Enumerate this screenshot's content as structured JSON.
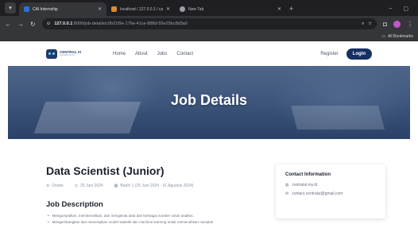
{
  "browser": {
    "tabs": [
      {
        "label": "CAI Internship",
        "active": true
      },
      {
        "label": "localhost / 127.0.0.1 / cai-inter",
        "active": false
      },
      {
        "label": "New Tab",
        "active": false
      }
    ],
    "url_host": "127.0.0.1",
    "url_path": ":8000/job-details/c0b21f9e-176e-41ce-888d-55e25bc8d3a0",
    "bookmarks_label": "All Bookmarks"
  },
  "site": {
    "logo_name": "CENTRAL AI",
    "logo_sub": "Innovation for All",
    "nav": [
      "Home",
      "About",
      "Jobs",
      "Contact"
    ],
    "register_label": "Register",
    "login_label": "Login"
  },
  "hero": {
    "title": "Job Details"
  },
  "job": {
    "title": "Data Scientist (Junior)",
    "location": "Onsite",
    "posted": "20 Juni 2024",
    "batch": "Batch 1 (25 Juni 2024 - 31 Agustus 2024)",
    "section_title": "Job Description",
    "description": [
      "Mengumpulkan, membersihkan, dan mengelola data dari berbagai sumber untuk analisis.",
      "Mengembangkan dan menerapkan model statistik dan machine learning untuk memecahkan masalah"
    ]
  },
  "contact": {
    "title": "Contact Information",
    "website": "centralai.my.id",
    "email": "contact.centralai@gmail.com"
  },
  "colors": {
    "primary": "#163064",
    "hero": "#4a6286"
  }
}
